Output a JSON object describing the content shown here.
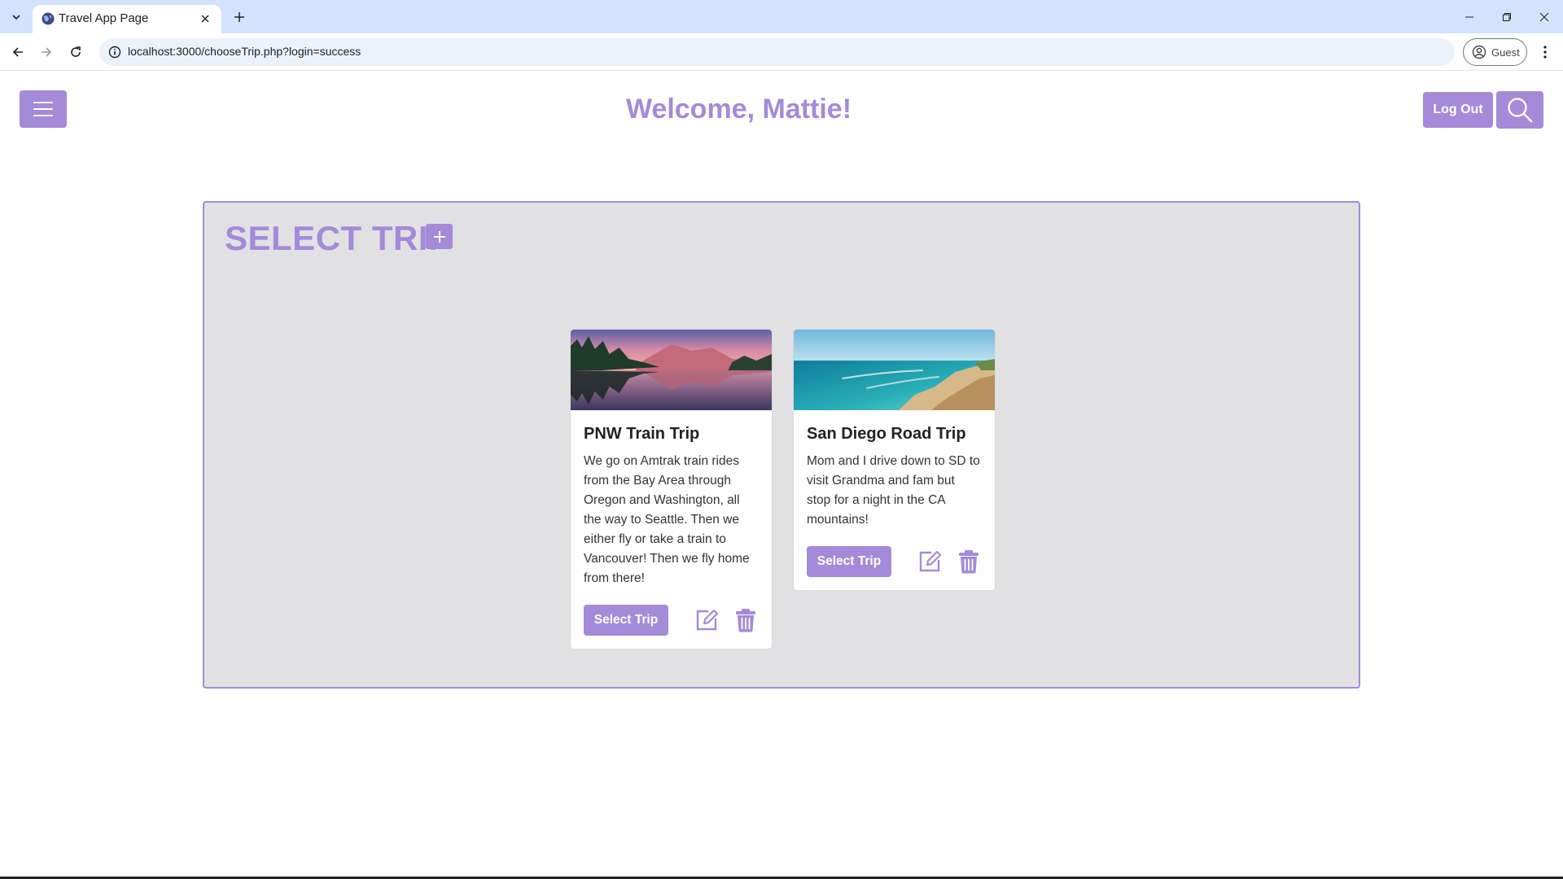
{
  "browser": {
    "tab_title": "Travel App Page",
    "url": "localhost:3000/chooseTrip.php?login=success",
    "profile_label": "Guest"
  },
  "header": {
    "welcome": "Welcome, Mattie!",
    "logout_label": "Log Out"
  },
  "panel": {
    "title": "SELECT TRIP"
  },
  "trips": [
    {
      "title": "PNW Train Trip",
      "description": "We go on Amtrak train rides from the Bay Area through Oregon and Washington, all the way to Seattle. Then we either fly or take a train to Vancouver! Then we fly home from there!",
      "select_label": "Select Trip",
      "image": "mountain-lake-image"
    },
    {
      "title": "San Diego Road Trip",
      "description": "Mom and I drive down to SD to visit Grandma and fam but stop for a night in the CA mountains!",
      "select_label": "Select Trip",
      "image": "beach-coast-image"
    }
  ],
  "colors": {
    "accent": "#a48ad8",
    "panel_bg": "#e1e1e4"
  }
}
